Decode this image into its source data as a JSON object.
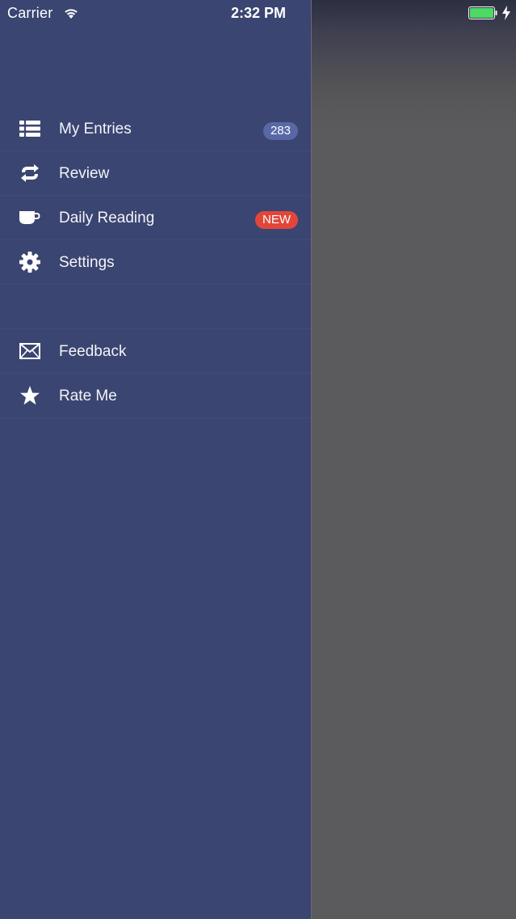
{
  "status_bar": {
    "carrier": "Carrier",
    "time": "2:32 PM",
    "battery_color": "#4cd964"
  },
  "menu": {
    "primary": [
      {
        "label": "My Entries",
        "icon": "list-icon",
        "badge": "283",
        "badge_type": "count"
      },
      {
        "label": "Review",
        "icon": "refresh-icon"
      },
      {
        "label": "Daily Reading",
        "icon": "cup-icon",
        "badge": "NEW",
        "badge_type": "new"
      },
      {
        "label": "Settings",
        "icon": "gear-icon"
      }
    ],
    "secondary": [
      {
        "label": "Feedback",
        "icon": "envelope-icon"
      },
      {
        "label": "Rate Me",
        "icon": "star-icon"
      }
    ]
  },
  "colors": {
    "drawer_bg": "#3a4571",
    "badge_count_bg": "#5868a6",
    "badge_new_bg": "#e2463a"
  }
}
